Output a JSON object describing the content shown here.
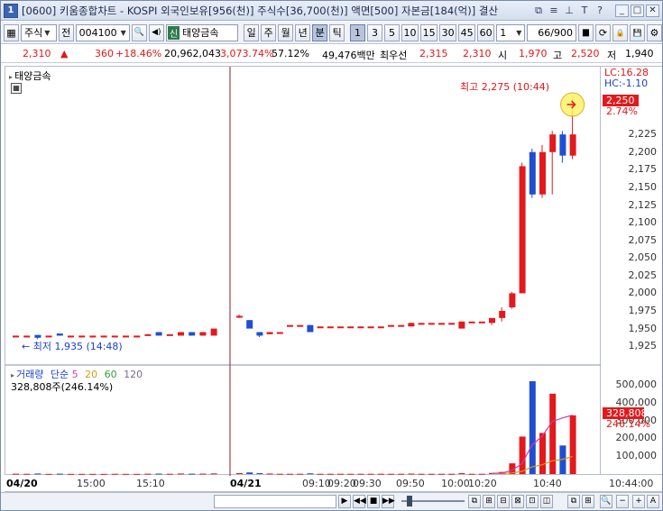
{
  "window": {
    "title": "[0600] 키움종합차트 - KOSPI 외국인보유[956(천)] 주식수[36,700(천)] 액면[500] 자본금[184(억)] 결산",
    "icon_text": "1",
    "ctl_icons": [
      "window-restore-icon",
      "menu-icon",
      "pin-icon",
      "text-T-icon",
      "help-icon"
    ],
    "ctl_glyphs": [
      "⧉",
      "≡",
      "⊥",
      "T",
      "?"
    ],
    "win_buttons": [
      "_",
      "□",
      "✕"
    ]
  },
  "toolbar": {
    "grid_icon": "▦",
    "type_select": "주식",
    "prev_label": "전",
    "code_value": "004100",
    "search_icon": "🔍",
    "sound_icon": "◀)",
    "stock_badge": "신",
    "stock_name": "태양금속",
    "periods": [
      "일",
      "주",
      "월",
      "년",
      "분",
      "틱"
    ],
    "active_period": "분",
    "intervals": [
      "1",
      "3",
      "5",
      "10",
      "15",
      "30",
      "45",
      "60"
    ],
    "active_interval": "1",
    "count_value": "1",
    "page_value": "66/900",
    "right_icons": [
      "bars-icon",
      "refresh-icon",
      "lock-icon",
      "save-icon",
      "settings-icon"
    ],
    "right_glyphs": [
      "▆",
      "⟳",
      "🔒",
      "💾",
      "⚙"
    ]
  },
  "quote": {
    "price": "2,310",
    "arrow": "▲",
    "change": "360",
    "change_pct": "+18.46%",
    "volume": "20,962,043",
    "vol_ratio": "3,073.74%",
    "turnover": "57.12%",
    "amount": "49,476백만",
    "best_label": "최우선",
    "best_ask": "2,315",
    "best_bid": "2,310",
    "open_label": "시",
    "open": "1,970",
    "high_label": "고",
    "high": "2,520",
    "low_label": "저",
    "low": "1,940"
  },
  "chart": {
    "panel_title": "태양금속",
    "high_annot": "최고 2,275 (10:44)",
    "low_annot": "최저 1,935 (14:48)",
    "lc": "LC:16.28",
    "hc": "HC:-1.10",
    "current_price_tag": "2,250",
    "current_pct_tag": "2.74%",
    "volume_title_parts": [
      "거래량",
      "단순",
      "5",
      "20",
      "60",
      "120"
    ],
    "volume_sub": "328,808주(246.14%)",
    "volume_tag": "328,808",
    "volume_pct_tag": "246.14%",
    "colors": {
      "up": "#e3191b",
      "down": "#1f4fd0",
      "ma5": "#d13ba6",
      "ma20": "#d49a14",
      "ma60": "#3a9a3a",
      "ma120": "#7a6a9a",
      "divider": "#8a1f2a"
    }
  },
  "chart_data": {
    "type": "candlestick",
    "price_axis": {
      "ticks": [
        "2,225",
        "2,200",
        "2,175",
        "2,150",
        "2,125",
        "2,100",
        "2,075",
        "2,050",
        "2,025",
        "2,000",
        "1,975",
        "1,950",
        "1,925"
      ],
      "min": 1915,
      "max": 2275
    },
    "volume_axis": {
      "ticks": [
        "500,000",
        "400,000",
        "300,000",
        "200,000",
        "100,000"
      ],
      "max": 540000
    },
    "x_ticks": [
      {
        "label": "04/20",
        "bold": true
      },
      {
        "label": "15:00"
      },
      {
        "label": "15:10"
      },
      {
        "label": "04/21",
        "bold": true
      },
      {
        "label": "09:10"
      },
      {
        "label": "09:20"
      },
      {
        "label": "09:30"
      },
      {
        "label": "09:50"
      },
      {
        "label": "10:00"
      },
      {
        "label": "10:20"
      },
      {
        "label": "10:40"
      },
      {
        "label": "10:44:00"
      }
    ],
    "candles": [
      {
        "o": 1940,
        "c": 1940,
        "h": 1940,
        "l": 1940,
        "v": 2000
      },
      {
        "o": 1940,
        "c": 1940,
        "h": 1940,
        "l": 1940,
        "v": 1500
      },
      {
        "o": 1941,
        "c": 1937,
        "h": 1941,
        "l": 1935,
        "v": 3000
      },
      {
        "o": 1940,
        "c": 1940,
        "h": 1940,
        "l": 1940,
        "v": 1000
      },
      {
        "o": 1943,
        "c": 1940,
        "h": 1943,
        "l": 1940,
        "v": 2000
      },
      {
        "o": 1940,
        "c": 1940,
        "h": 1940,
        "l": 1940,
        "v": 1000
      },
      {
        "o": 1940,
        "c": 1940,
        "h": 1940,
        "l": 1940,
        "v": 1000
      },
      {
        "o": 1940,
        "c": 1940,
        "h": 1940,
        "l": 1940,
        "v": 1000
      },
      {
        "o": 1940,
        "c": 1940,
        "h": 1940,
        "l": 1940,
        "v": 1000
      },
      {
        "o": 1940,
        "c": 1940,
        "h": 1940,
        "l": 1940,
        "v": 1500
      },
      {
        "o": 1940,
        "c": 1940,
        "h": 1940,
        "l": 1940,
        "v": 1000
      },
      {
        "o": 1940,
        "c": 1940,
        "h": 1940,
        "l": 1940,
        "v": 1000
      },
      {
        "o": 1940,
        "c": 1942,
        "h": 1942,
        "l": 1940,
        "v": 2000
      },
      {
        "o": 1945,
        "c": 1940,
        "h": 1945,
        "l": 1940,
        "v": 2500
      },
      {
        "o": 1942,
        "c": 1942,
        "h": 1942,
        "l": 1942,
        "v": 1500
      },
      {
        "o": 1940,
        "c": 1945,
        "h": 1945,
        "l": 1940,
        "v": 3000
      },
      {
        "o": 1945,
        "c": 1940,
        "h": 1945,
        "l": 1940,
        "v": 2000
      },
      {
        "o": 1940,
        "c": 1945,
        "h": 1945,
        "l": 1940,
        "v": 2500
      },
      {
        "o": 1940,
        "c": 1950,
        "h": 1950,
        "l": 1940,
        "v": 3500
      },
      {
        "o": 1968,
        "c": 1968,
        "h": 1970,
        "l": 1965,
        "v": 5000
      },
      {
        "o": 1962,
        "c": 1950,
        "h": 1962,
        "l": 1950,
        "v": 9000
      },
      {
        "o": 1945,
        "c": 1940,
        "h": 1945,
        "l": 1938,
        "v": 5000
      },
      {
        "o": 1942,
        "c": 1945,
        "h": 1945,
        "l": 1942,
        "v": 3000
      },
      {
        "o": 1945,
        "c": 1945,
        "h": 1945,
        "l": 1945,
        "v": 1500
      },
      {
        "o": 1955,
        "c": 1955,
        "h": 1955,
        "l": 1955,
        "v": 1500
      },
      {
        "o": 1955,
        "c": 1955,
        "h": 1955,
        "l": 1955,
        "v": 1500
      },
      {
        "o": 1955,
        "c": 1945,
        "h": 1955,
        "l": 1945,
        "v": 4000
      },
      {
        "o": 1953,
        "c": 1953,
        "h": 1953,
        "l": 1953,
        "v": 1500
      },
      {
        "o": 1953,
        "c": 1953,
        "h": 1953,
        "l": 1953,
        "v": 1500
      },
      {
        "o": 1953,
        "c": 1953,
        "h": 1953,
        "l": 1953,
        "v": 1500
      },
      {
        "o": 1953,
        "c": 1953,
        "h": 1953,
        "l": 1953,
        "v": 1500
      },
      {
        "o": 1953,
        "c": 1953,
        "h": 1953,
        "l": 1953,
        "v": 1500
      },
      {
        "o": 1953,
        "c": 1953,
        "h": 1953,
        "l": 1953,
        "v": 1500
      },
      {
        "o": 1953,
        "c": 1953,
        "h": 1953,
        "l": 1953,
        "v": 1500
      },
      {
        "o": 1955,
        "c": 1955,
        "h": 1955,
        "l": 1955,
        "v": 1500
      },
      {
        "o": 1955,
        "c": 1955,
        "h": 1955,
        "l": 1955,
        "v": 1500
      },
      {
        "o": 1953,
        "c": 1958,
        "h": 1958,
        "l": 1953,
        "v": 2500
      },
      {
        "o": 1958,
        "c": 1958,
        "h": 1958,
        "l": 1958,
        "v": 1500
      },
      {
        "o": 1958,
        "c": 1958,
        "h": 1958,
        "l": 1958,
        "v": 1500
      },
      {
        "o": 1958,
        "c": 1958,
        "h": 1958,
        "l": 1958,
        "v": 1500
      },
      {
        "o": 1958,
        "c": 1958,
        "h": 1958,
        "l": 1958,
        "v": 1500
      },
      {
        "o": 1950,
        "c": 1960,
        "h": 1960,
        "l": 1950,
        "v": 5000
      },
      {
        "o": 1960,
        "c": 1960,
        "h": 1960,
        "l": 1960,
        "v": 1500
      },
      {
        "o": 1960,
        "c": 1960,
        "h": 1960,
        "l": 1960,
        "v": 1500
      },
      {
        "o": 1958,
        "c": 1965,
        "h": 1965,
        "l": 1955,
        "v": 6000
      },
      {
        "o": 1965,
        "c": 1975,
        "h": 1980,
        "l": 1960,
        "v": 12000
      },
      {
        "o": 1980,
        "c": 2000,
        "h": 2002,
        "l": 1978,
        "v": 60000
      },
      {
        "o": 2000,
        "c": 2180,
        "h": 2185,
        "l": 2000,
        "v": 210000
      },
      {
        "o": 2200,
        "c": 2140,
        "h": 2205,
        "l": 2135,
        "v": 520000
      },
      {
        "o": 2140,
        "c": 2200,
        "h": 2210,
        "l": 2135,
        "v": 230000
      },
      {
        "o": 2200,
        "c": 2225,
        "h": 2230,
        "l": 2140,
        "v": 450000
      },
      {
        "o": 2225,
        "c": 2195,
        "h": 2230,
        "l": 2185,
        "v": 160000
      },
      {
        "o": 2195,
        "c": 2225,
        "h": 2275,
        "l": 2190,
        "v": 328808
      }
    ],
    "ma5_volume": [
      1,
      1,
      1,
      1,
      1,
      1,
      1,
      1,
      1,
      1,
      1,
      1,
      1,
      1,
      1,
      1,
      1,
      1,
      1,
      1,
      1,
      1,
      1,
      1,
      1,
      1,
      1,
      1,
      1,
      1,
      1,
      1,
      1,
      1,
      1,
      1,
      1,
      1,
      1,
      1,
      1,
      1,
      1,
      1,
      4000,
      6000,
      20000,
      58000,
      162000,
      212000,
      294000,
      314000,
      330000
    ],
    "ma20_volume": [
      1,
      1,
      1,
      1,
      1,
      1,
      1,
      1,
      1,
      1,
      1,
      1,
      1,
      1,
      1,
      1,
      1,
      1,
      1,
      1,
      1,
      1,
      1,
      1,
      1,
      1,
      1,
      1,
      1,
      1,
      1,
      1,
      1,
      1,
      1,
      1,
      1,
      1,
      1,
      1,
      1,
      1,
      1,
      1,
      3000,
      3500,
      6000,
      15000,
      40000,
      52000,
      74000,
      82000,
      98000
    ]
  },
  "scrollbar": {
    "buttons": [
      "▶",
      "◀◀",
      "■",
      "▶▶",
      "◀"
    ],
    "icons": [
      "⧉",
      "⊞",
      "⊟",
      "⊠",
      "⊡",
      "◫",
      "🔍",
      "−",
      "+",
      "A"
    ]
  }
}
